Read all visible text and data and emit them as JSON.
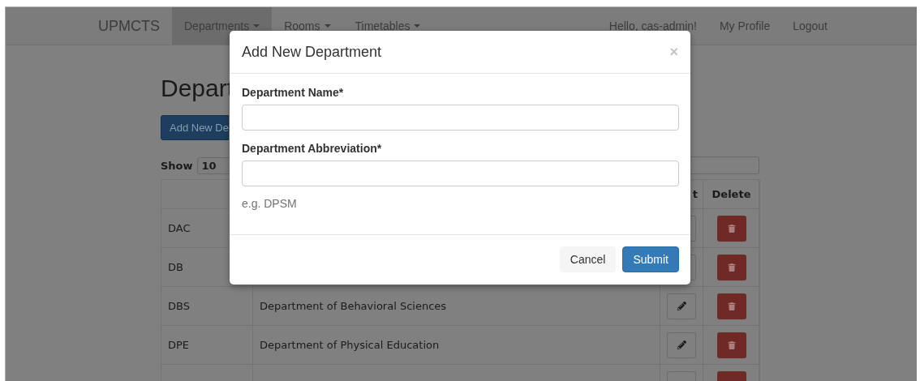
{
  "navbar": {
    "brand": "UPMCTS",
    "menus": [
      {
        "label": "Departments",
        "selected": true
      },
      {
        "label": "Rooms",
        "selected": false
      },
      {
        "label": "Timetables",
        "selected": false
      }
    ],
    "links": [
      "Hello, cas-admin!",
      "My Profile",
      "Logout"
    ]
  },
  "page": {
    "title": "Depart",
    "add_button": "Add New De",
    "show_label": "Show",
    "page_size": "10"
  },
  "table": {
    "columns": [
      {
        "label": "t"
      },
      {
        "label": "Delete"
      }
    ],
    "rows": [
      {
        "abbreviation": "DAC"
      },
      {
        "abbreviation": "DB"
      },
      {
        "abbreviation": "DBS",
        "name": "Department of Behavioral Sciences"
      },
      {
        "abbreviation": "DPE",
        "name": "Department of Physical Education"
      },
      {
        "kind": "partial"
      }
    ]
  },
  "modal": {
    "title": "Add New Department",
    "close": "×",
    "fields": [
      {
        "label": "Department Name*"
      },
      {
        "label": "Department Abbreviation*",
        "help": "e.g. DPSM"
      }
    ],
    "buttons": [
      {
        "label": "Cancel",
        "kind": "default"
      },
      {
        "label": "Submit",
        "kind": "primary"
      }
    ]
  }
}
